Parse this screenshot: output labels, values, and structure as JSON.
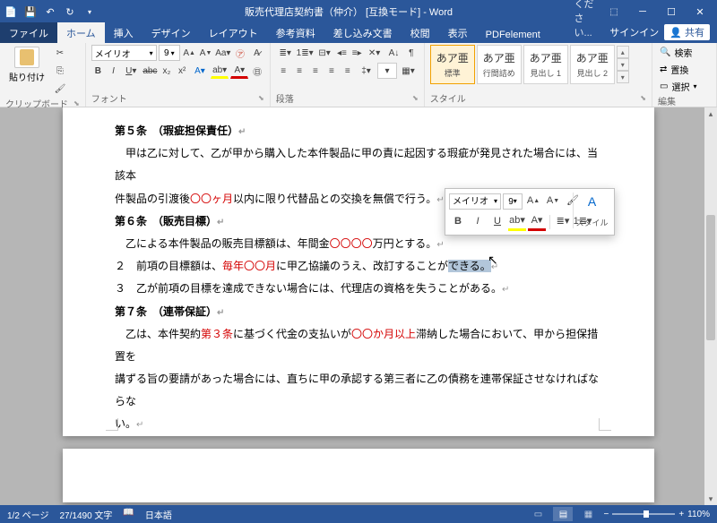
{
  "title": "販売代理店契約書（仲介）  [互換モード] - Word",
  "tabs": {
    "file": "ファイル",
    "home": "ホーム",
    "insert": "挿入",
    "design": "デザイン",
    "layout": "レイアウト",
    "references": "参考資料",
    "mailings": "差し込み文書",
    "review": "校閲",
    "view": "表示",
    "pdfelement": "PDFelement"
  },
  "tell": "実行したい作業を入力してください...",
  "signin": "サインイン",
  "share": "共有",
  "ribbon": {
    "clipboard": {
      "label": "クリップボード",
      "paste": "貼り付け"
    },
    "font": {
      "label": "フォント",
      "name": "メイリオ",
      "size": "9"
    },
    "paragraph": {
      "label": "段落"
    },
    "styles": {
      "label": "スタイル",
      "items": [
        {
          "prev": "あア亜",
          "name": "標準"
        },
        {
          "prev": "あア亜",
          "name": "行間詰め"
        },
        {
          "prev": "あア亜",
          "name": "見出し 1"
        },
        {
          "prev": "あア亜",
          "name": "見出し 2"
        }
      ]
    },
    "editing": {
      "label": "編集",
      "find": "検索",
      "replace": "置換",
      "select": "選択"
    }
  },
  "doc": {
    "l1": "第５条　（瑕疵担保責任）",
    "l2": "　甲は乙に対して、乙が甲から購入した本件製品に甲の責に起因する瑕疵が発見された場合には、当該本",
    "l3a": "件製品の引渡後",
    "l3b": "〇〇ヶ月",
    "l3c": "以内に限り代替品との交換を無償で行う。",
    "l4": "第６条　（販売目標）",
    "l5a": "　乙による本件製品の販売目標額は、年間金",
    "l5b": "〇〇〇〇",
    "l5c": "万円とする。",
    "l6a": "２　前項の目標額は、",
    "l6b": "毎年〇〇月",
    "l6c": "に甲乙協議のうえ、改訂することが",
    "l6d": "できる。",
    "l7": "３　乙が前項の目標を達成できない場合には、代理店の資格を失うことがある。",
    "l8": "第７条　（連帯保証）",
    "l9a": "　乙は、本件契約",
    "l9b": "第３条",
    "l9c": "に基づく代金の支払いが",
    "l9d": "〇〇か月以上",
    "l9e": "滞納した場合において、甲から担保措置を",
    "l10": "講ずる旨の要請があった場合には、直ちに甲の承認する第三者に乙の債務を連帯保証させなければならな",
    "l11": "い。"
  },
  "mini": {
    "font": "メイリオ",
    "size": "9",
    "styles": "スタイル"
  },
  "status": {
    "page": "1/2 ページ",
    "words": "27/1490 文字",
    "lang": "日本語",
    "zoom": "110%"
  }
}
